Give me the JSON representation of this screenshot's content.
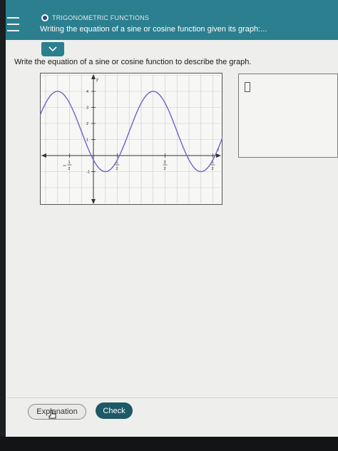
{
  "header": {
    "topic": "TRIGONOMETRIC FUNCTIONS",
    "title": "Writing the equation of a sine or cosine function given its graph:..."
  },
  "question": {
    "prompt": "Write the equation of a sine or cosine function to describe the graph."
  },
  "graph": {
    "axis_x_label": "x",
    "axis_y_label": "y",
    "y_ticks": [
      "4",
      "3",
      "2",
      "1",
      "-1"
    ],
    "x_ticks": [
      {
        "value": -0.5,
        "num": "1",
        "den": "2",
        "neg": true
      },
      {
        "value": 0.5,
        "num": "1",
        "den": "2",
        "neg": false
      },
      {
        "value": 1.5,
        "num": "3",
        "den": "2",
        "neg": false
      },
      {
        "value": 2.5,
        "num": "5",
        "den": "2",
        "neg": false
      }
    ],
    "curve": {
      "function": "cosine",
      "amplitude": 2.5,
      "midline": 1.5,
      "period": 2,
      "phase": -0.75
    },
    "colors": {
      "curve": "#6f63c9",
      "grid": "#c9c9c9",
      "axis": "#333333"
    }
  },
  "answer": {
    "value": ""
  },
  "footer": {
    "explanation_label": "Explanation",
    "check_label": "Check"
  }
}
